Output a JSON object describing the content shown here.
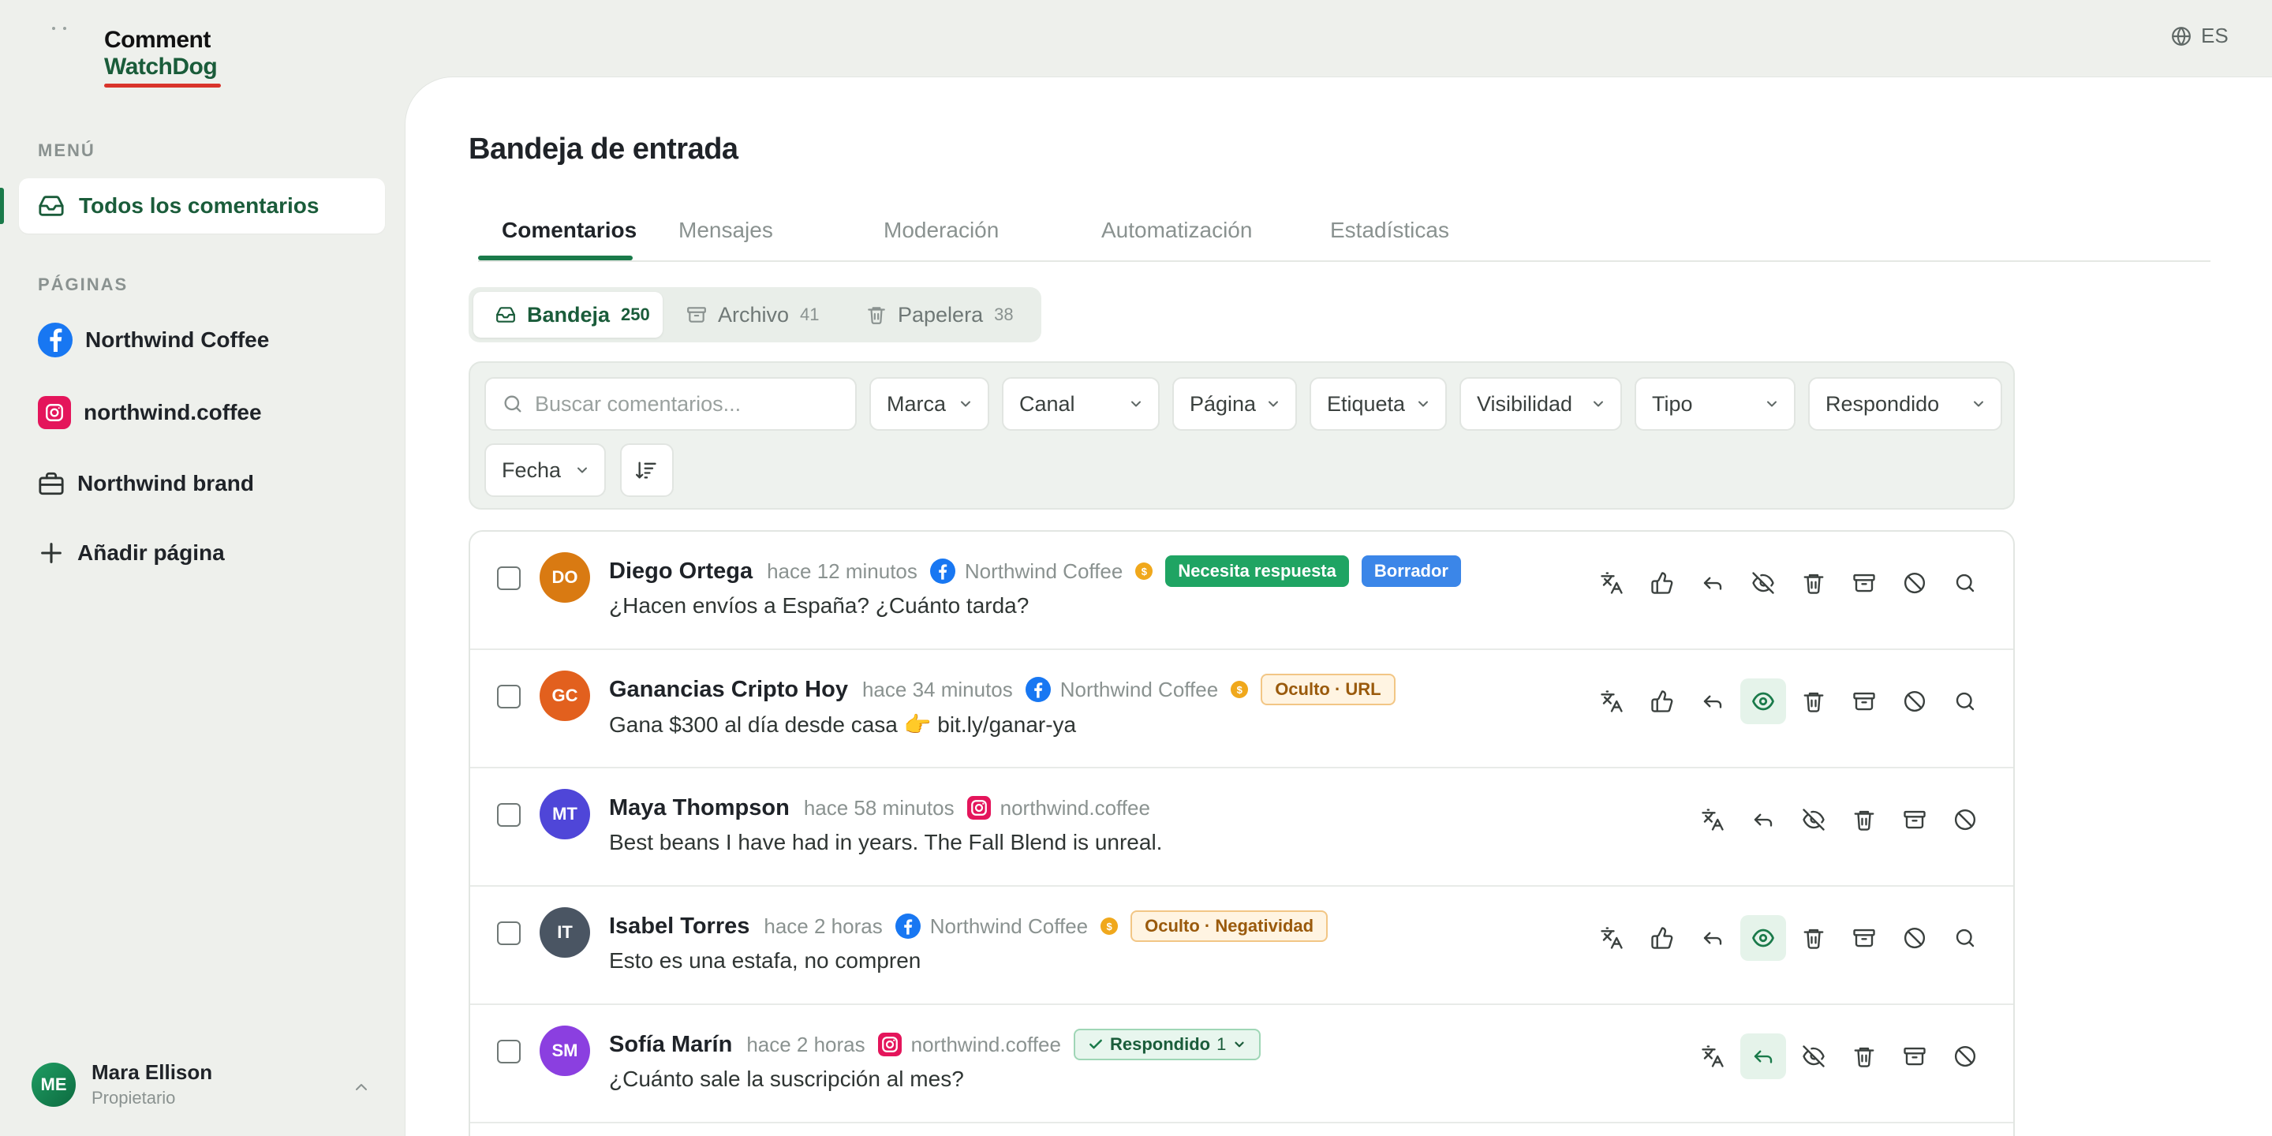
{
  "brand": {
    "line1": "Comment",
    "line2": "WatchDog"
  },
  "language": "ES",
  "sidebar": {
    "menu_label": "MENÚ",
    "menu_items": [
      {
        "label": "Todos los comentarios",
        "icon": "inbox-icon"
      }
    ],
    "pages_label": "PÁGINAS",
    "pages": [
      {
        "label": "Northwind Coffee",
        "icon": "facebook-icon"
      },
      {
        "label": "northwind.coffee",
        "icon": "instagram-icon"
      },
      {
        "label": "Northwind brand",
        "icon": "briefcase-icon"
      }
    ],
    "add_page": "Añadir página",
    "user": {
      "initials": "ME",
      "name": "Mara Ellison",
      "role": "Propietario"
    }
  },
  "main": {
    "title": "Bandeja de entrada",
    "tabs": [
      "Comentarios",
      "Mensajes",
      "Moderación",
      "Automatización",
      "Estadísticas"
    ],
    "segments": [
      {
        "label": "Bandeja",
        "count": "250"
      },
      {
        "label": "Archivo",
        "count": "41"
      },
      {
        "label": "Papelera",
        "count": "38"
      }
    ],
    "search_placeholder": "Buscar comentarios...",
    "filters": [
      "Marca",
      "Canal",
      "Página",
      "Etiqueta",
      "Visibilidad",
      "Tipo",
      "Respondido",
      "Fecha"
    ]
  },
  "comments": [
    {
      "initials": "DO",
      "author": "Diego Ortega",
      "time": "hace 12 minutos",
      "source": "Northwind Coffee",
      "platform": "facebook",
      "coin": "$",
      "badges": [
        {
          "text": "Necesita respuesta",
          "style": "green"
        },
        {
          "text": "Borrador",
          "style": "blue"
        }
      ],
      "text": "¿Hacen envíos a España? ¿Cuánto tarda?",
      "avatar_color": "#d97a12"
    },
    {
      "initials": "GC",
      "author": "Ganancias Cripto Hoy",
      "time": "hace 34 minutos",
      "source": "Northwind Coffee",
      "platform": "facebook",
      "coin": "$",
      "badges": [
        {
          "text": "Oculto · URL",
          "style": "orange"
        }
      ],
      "text": "Gana $300 al día desde casa 👉  bit.ly/ganar-ya",
      "avatar_color": "#e2601e"
    },
    {
      "initials": "MT",
      "author": "Maya Thompson",
      "time": "hace 58 minutos",
      "source": "northwind.coffee",
      "platform": "instagram",
      "badges": [],
      "text": "Best beans I have had in years. The Fall Blend is unreal.",
      "avatar_color": "#4f46d8"
    },
    {
      "initials": "IT",
      "author": "Isabel Torres",
      "time": "hace 2 horas",
      "source": "Northwind Coffee",
      "platform": "facebook",
      "coin": "$",
      "badges": [
        {
          "text": "Oculto · Negatividad",
          "style": "orange"
        }
      ],
      "text": "Esto es una estafa, no compren",
      "avatar_color": "#4a5563"
    },
    {
      "initials": "SM",
      "author": "Sofía Marín",
      "time": "hace 2 horas",
      "source": "northwind.coffee",
      "platform": "instagram",
      "badges": [
        {
          "text": "Respondido",
          "style": "replied",
          "count": "1"
        }
      ],
      "text": "¿Cuánto sale la suscripción al mes?",
      "avatar_color": "#8b3fe0"
    }
  ]
}
